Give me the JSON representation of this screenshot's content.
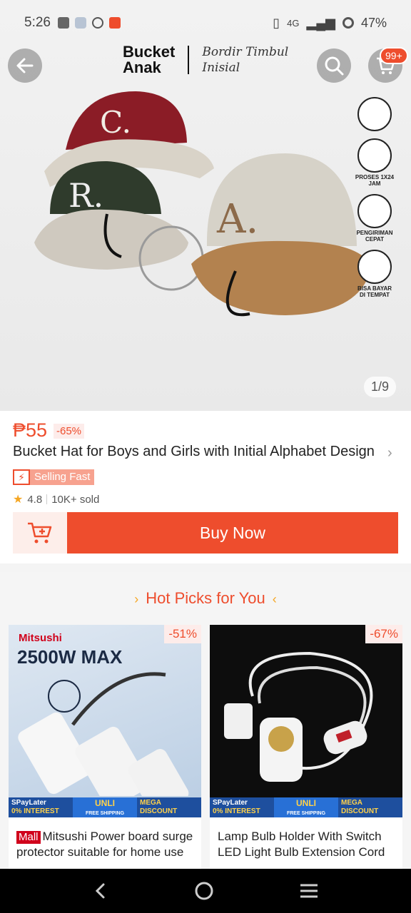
{
  "status_bar": {
    "time": "5:26",
    "network": "4G",
    "battery": "47%"
  },
  "hero": {
    "title_line1": "Bucket",
    "title_line2": "Anak",
    "subtitle_line1": "Bordir Timbul",
    "subtitle_line2": "Inisial",
    "cart_badge": "99+",
    "page_indicator": "1/9",
    "side_badges": [
      "PROSES 1X24 JAM",
      "PENGIRIMAN CEPAT",
      "BISA BAYAR DI TEMPAT"
    ]
  },
  "product": {
    "price": "₱55",
    "discount": "-65%",
    "title": "Bucket Hat for Boys and Girls with Initial Alphabet Design",
    "selling_tag": "Selling Fast",
    "rating": "4.8",
    "sold": "10K+ sold",
    "buy_now_label": "Buy Now"
  },
  "hot_picks": {
    "heading": "Hot Picks for You",
    "items": [
      {
        "badge": "Mall",
        "title": "Mitsushi Power board surge protector suitable for home use",
        "discount": "-51%",
        "brand": "Mitsushi",
        "headline": "2500W MAX"
      },
      {
        "title": "Lamp Bulb Holder With Switch LED Light Bulb Extension Cord",
        "discount": "-67%"
      }
    ],
    "promo": {
      "spaylater": "SPayLater",
      "interest": "0% INTEREST",
      "unli": "UNLI",
      "free_shipping": "FREE SHIPPING",
      "mega": "MEGA",
      "discount": "DISCOUNT"
    }
  }
}
